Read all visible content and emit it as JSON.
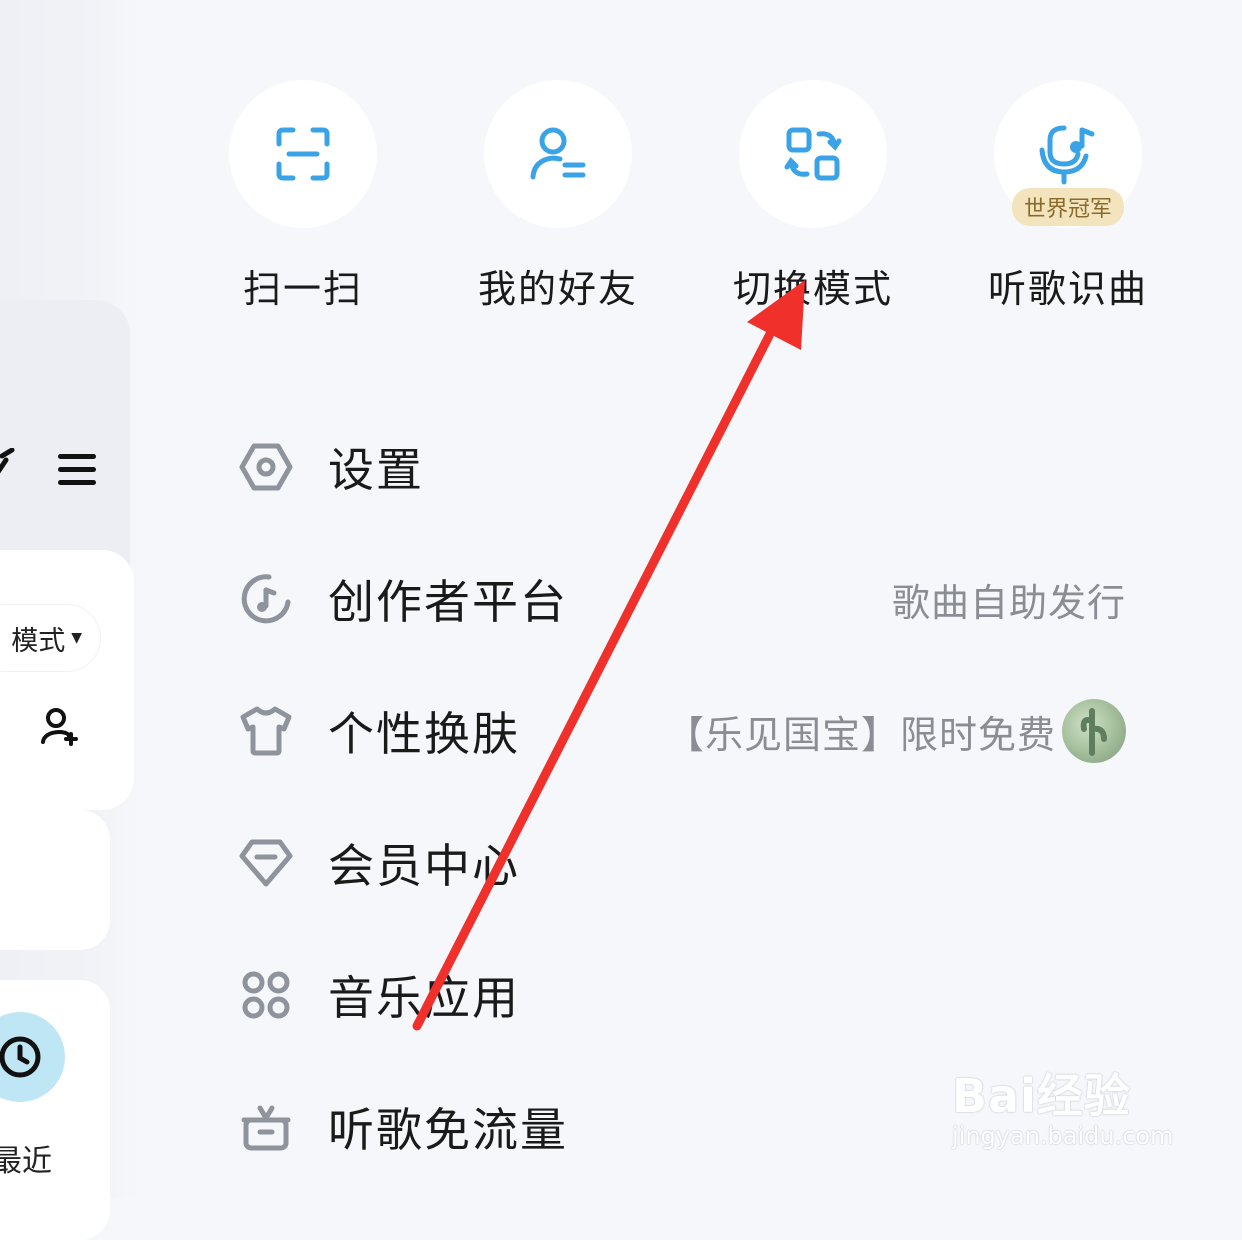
{
  "underlay": {
    "mode_label": "模式",
    "recent_label": "最近"
  },
  "quick_actions": [
    {
      "label": "扫一扫",
      "icon": "scan-icon"
    },
    {
      "label": "我的好友",
      "icon": "friends-icon"
    },
    {
      "label": "切换模式",
      "icon": "switch-mode-icon"
    },
    {
      "label": "听歌识曲",
      "icon": "mic-music-icon",
      "badge": "世界冠军"
    }
  ],
  "menu": [
    {
      "label": "设置",
      "icon": "settings-icon"
    },
    {
      "label": "创作者平台",
      "icon": "creator-icon",
      "side": "歌曲自助发行"
    },
    {
      "label": "个性换肤",
      "icon": "tshirt-icon",
      "side": "【乐见国宝】限时免费"
    },
    {
      "label": "会员中心",
      "icon": "diamond-icon"
    },
    {
      "label": "音乐应用",
      "icon": "apps-icon"
    },
    {
      "label": "听歌免流量",
      "icon": "gift-icon"
    }
  ],
  "watermark": {
    "main": "Bai经验",
    "sub": "jingyan.baidu.com"
  },
  "colors": {
    "accent_blue": "#3aa3e8",
    "icon_gray": "#8e939c",
    "arrow_red": "#f0302a",
    "badge_bg": "#f3e4be"
  }
}
